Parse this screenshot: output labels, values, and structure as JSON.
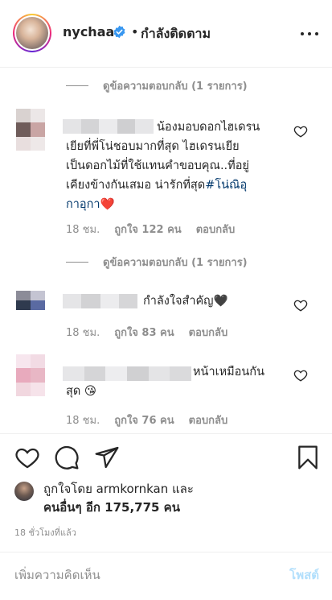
{
  "header": {
    "username": "nychaa",
    "separator": "•",
    "follow_status": "กำลังติดตาม",
    "icons": {
      "verified": "verified-badge-icon",
      "more": "more-options-icon"
    },
    "colors": {
      "verified": "#3897f0"
    }
  },
  "comments": [
    {
      "view_replies": "ดูข้อความตอบกลับ (1 รายการ)",
      "text": "น้องมอบดอกไฮเดรนเยียที่พี่โน่ชอบมากที่สุด ไฮเดรนเยียเป็นดอกไม้ที่ใช้แทนคำขอบคุณ..ที่อยู่เคียงข้างกันเสมอ น่ารักที่สุด",
      "lines": [
        "น้องมอบดอกไฮเดรน",
        "เยียที่พี่โน่ชอบมากที่สุด ไฮเดรนเยีย",
        "เป็นดอกไม้ที่ใช้แทนคำขอบคุณ..ที่อยู่",
        "เคียงข้างกันเสมอ น่ารักที่สุด"
      ],
      "hashtag_part1": "#โน่ณิอุ",
      "hashtag_part2": "กาอุกา",
      "emoji": "❤️",
      "time": "18 ชม.",
      "likes": "ถูกใจ 122 คน",
      "reply": "ตอบกลับ"
    },
    {
      "view_replies": "ดูข้อความตอบกลับ (1 รายการ)",
      "text": "กำลังใจสำคัญ🖤",
      "time": "18 ชม.",
      "likes": "ถูกใจ 83 คน",
      "reply": "ตอบกลับ"
    },
    {
      "line1": "หน้าเหมือนกัน",
      "line2": "สุด",
      "emoji": "😘",
      "time": "18 ชม.",
      "likes": "ถูกใจ 76 คน",
      "reply": "ตอบกลับ"
    }
  ],
  "actions": {
    "icons": [
      "heart-icon",
      "comment-icon",
      "share-icon",
      "bookmark-icon"
    ]
  },
  "likes_summary": {
    "line1": "ถูกใจโดย armkornkan และ",
    "line2": "คนอื่นๆ อีก 175,775 คน"
  },
  "timestamp": "18 ชั่วโมงที่แล้ว",
  "comment_box": {
    "placeholder": "เพิ่มความคิดเห็น",
    "post_label": "โพสต์"
  }
}
